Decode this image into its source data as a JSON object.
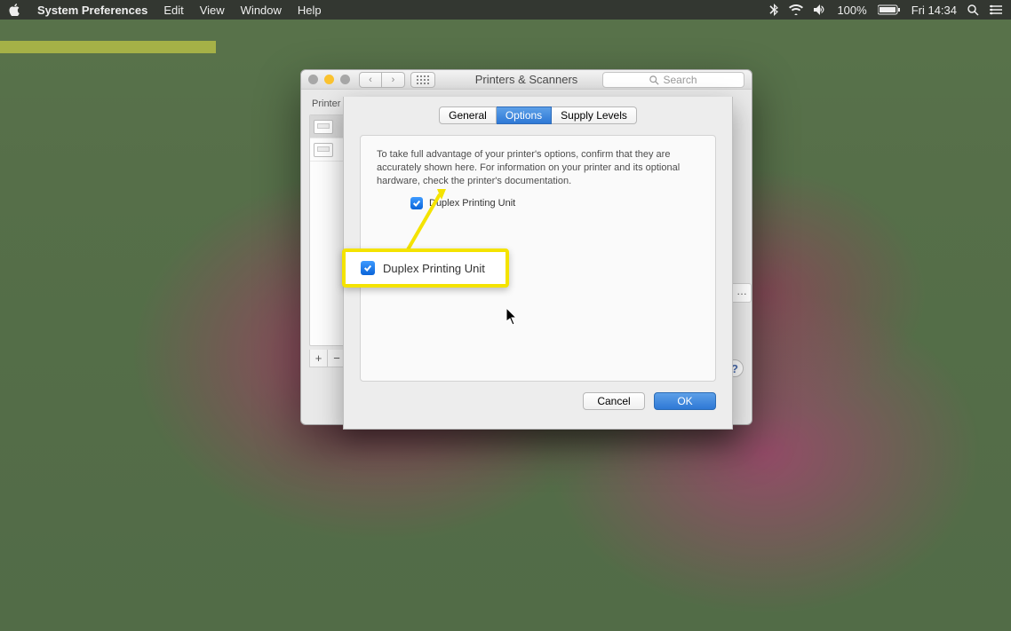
{
  "menubar": {
    "app": "System Preferences",
    "items": [
      "Edit",
      "View",
      "Window",
      "Help"
    ],
    "status": {
      "battery": "100%",
      "clock": "Fri 14:34"
    }
  },
  "window": {
    "title": "Printers & Scanners",
    "search_placeholder": "Search",
    "sidebar_header": "Printer",
    "add_label": "+",
    "remove_label": "−",
    "help_label": "?"
  },
  "sheet": {
    "tabs": {
      "general": "General",
      "options": "Options",
      "supply": "Supply Levels"
    },
    "hint": "To take full advantage of your printer's options, confirm that they are accurately shown here. For information on your printer and its optional hardware, check the printer's documentation.",
    "option_label": "Duplex Printing Unit",
    "option_checked": true,
    "cancel": "Cancel",
    "ok": "OK"
  },
  "callout": {
    "label": "Duplex Printing Unit"
  }
}
